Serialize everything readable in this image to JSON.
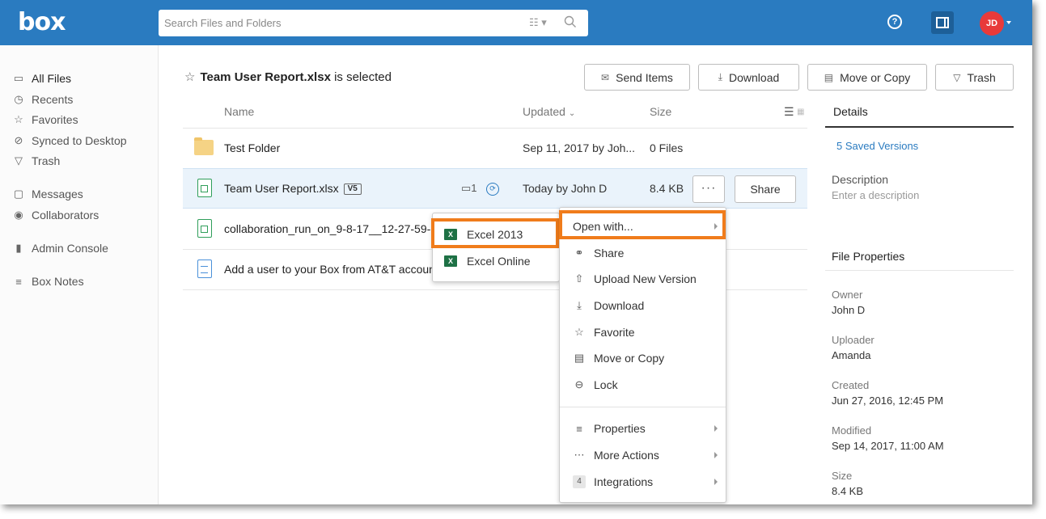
{
  "header": {
    "logo": "box",
    "search_placeholder": "Search Files and Folders",
    "help": "?",
    "avatar_initials": "JD",
    "brand_color": "#2a7bc0"
  },
  "sidebar": {
    "items": [
      {
        "label": "All Files",
        "icon": "folder-icon"
      },
      {
        "label": "Recents",
        "icon": "clock-icon"
      },
      {
        "label": "Favorites",
        "icon": "star-icon"
      },
      {
        "label": "Synced to Desktop",
        "icon": "check-circle-icon"
      },
      {
        "label": "Trash",
        "icon": "trash-icon"
      },
      {
        "label": "Messages",
        "icon": "message-icon"
      },
      {
        "label": "Collaborators",
        "icon": "user-icon"
      },
      {
        "label": "Admin Console",
        "icon": "bar-chart-icon"
      },
      {
        "label": "Box Notes",
        "icon": "notes-icon"
      }
    ]
  },
  "toolbar": {
    "selected_name": "Team User Report.xlsx",
    "selected_suffix": " is selected",
    "send_items": "Send Items",
    "download": "Download",
    "move_copy": "Move or Copy",
    "trash": "Trash"
  },
  "table": {
    "headers": {
      "name": "Name",
      "updated": "Updated",
      "size": "Size"
    },
    "rows": [
      {
        "name": "Test Folder",
        "updated": "Sep 11, 2017 by Joh...",
        "size": "0 Files",
        "type": "folder"
      },
      {
        "name": "Team User Report.xlsx",
        "version": "V5",
        "comments": "1",
        "updated": "Today by John D",
        "size": "8.4 KB",
        "type": "xlsx",
        "share": "Share",
        "more": "···"
      },
      {
        "name": "collaboration_run_on_9-8-17__12-27-59-PM",
        "type": "xlsx"
      },
      {
        "name": "Add a user to your Box from AT&T account...",
        "type": "doc"
      }
    ]
  },
  "details": {
    "tab": "Details",
    "saved_versions": "5 Saved Versions",
    "description_label": "Description",
    "description_placeholder": "Enter a description",
    "file_properties": "File Properties",
    "owner_label": "Owner",
    "owner": "John D",
    "uploader_label": "Uploader",
    "uploader": "Amanda",
    "created_label": "Created",
    "created": "Jun 27, 2016, 12:45 PM",
    "modified_label": "Modified",
    "modified": "Sep 14, 2017, 11:00 AM",
    "size_label": "Size",
    "size": "8.4 KB"
  },
  "context_menu": {
    "items": [
      {
        "label": "Open with...",
        "submenu": true
      },
      {
        "label": "Share",
        "icon": "link-icon"
      },
      {
        "label": "Upload New Version",
        "icon": "upload-icon"
      },
      {
        "label": "Download",
        "icon": "download-icon"
      },
      {
        "label": "Favorite",
        "icon": "star-icon"
      },
      {
        "label": "Move or Copy",
        "icon": "copy-icon"
      },
      {
        "label": "Lock",
        "icon": "lock-icon"
      },
      {
        "label": "Properties",
        "icon": "properties-icon",
        "submenu": true
      },
      {
        "label": "More Actions",
        "icon": "ellipsis-icon",
        "submenu": true
      },
      {
        "label": "Integrations",
        "badge": "4",
        "submenu": true
      }
    ]
  },
  "open_with_menu": {
    "items": [
      {
        "label": "Excel 2013",
        "icon": "excel-icon"
      },
      {
        "label": "Excel Online",
        "icon": "excel-icon"
      }
    ]
  },
  "highlight_color": "#f07c1b"
}
